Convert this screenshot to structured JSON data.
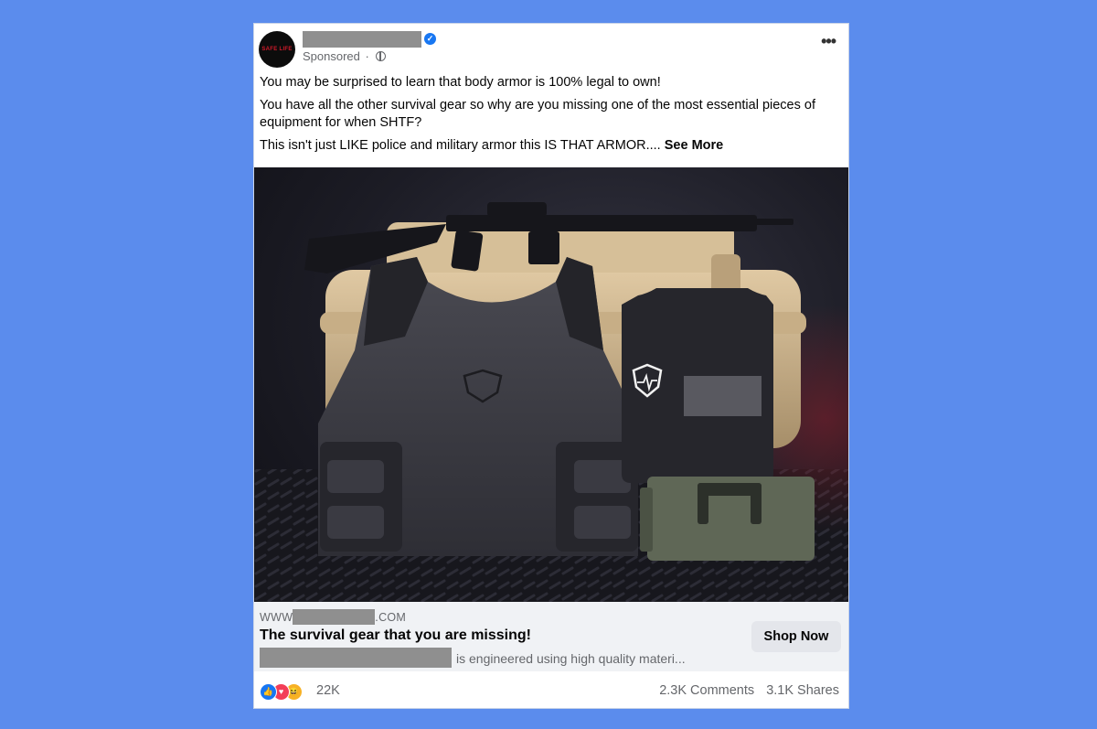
{
  "post": {
    "sponsored_label": "Sponsored",
    "separator": "·",
    "more_options": "•••",
    "avatar_logo_text": "SAFE LIFE",
    "text": {
      "p1": "You may be surprised to learn that body armor is 100% legal to own!",
      "p2": "You have all the other survival gear so why are you missing one of the most essential pieces of equipment for when SHTF?",
      "p3": "This isn't just LIKE police and military armor this IS THAT ARMOR....",
      "see_more": "See More"
    }
  },
  "link": {
    "domain_prefix": "WWW",
    "domain_suffix": ".COM",
    "title": "The survival gear that you are missing!",
    "description": "is engineered using high quality materi...",
    "cta_label": "Shop Now"
  },
  "engagement": {
    "reaction_count": "22K",
    "comments": "2.3K Comments",
    "shares": "3.1K Shares"
  },
  "icons": {
    "like": "👍",
    "love": "♥",
    "haha": "😆"
  },
  "colors": {
    "background": "#5b8ced",
    "facebook_blue": "#1877f2",
    "redaction": "#8f8f8f"
  }
}
